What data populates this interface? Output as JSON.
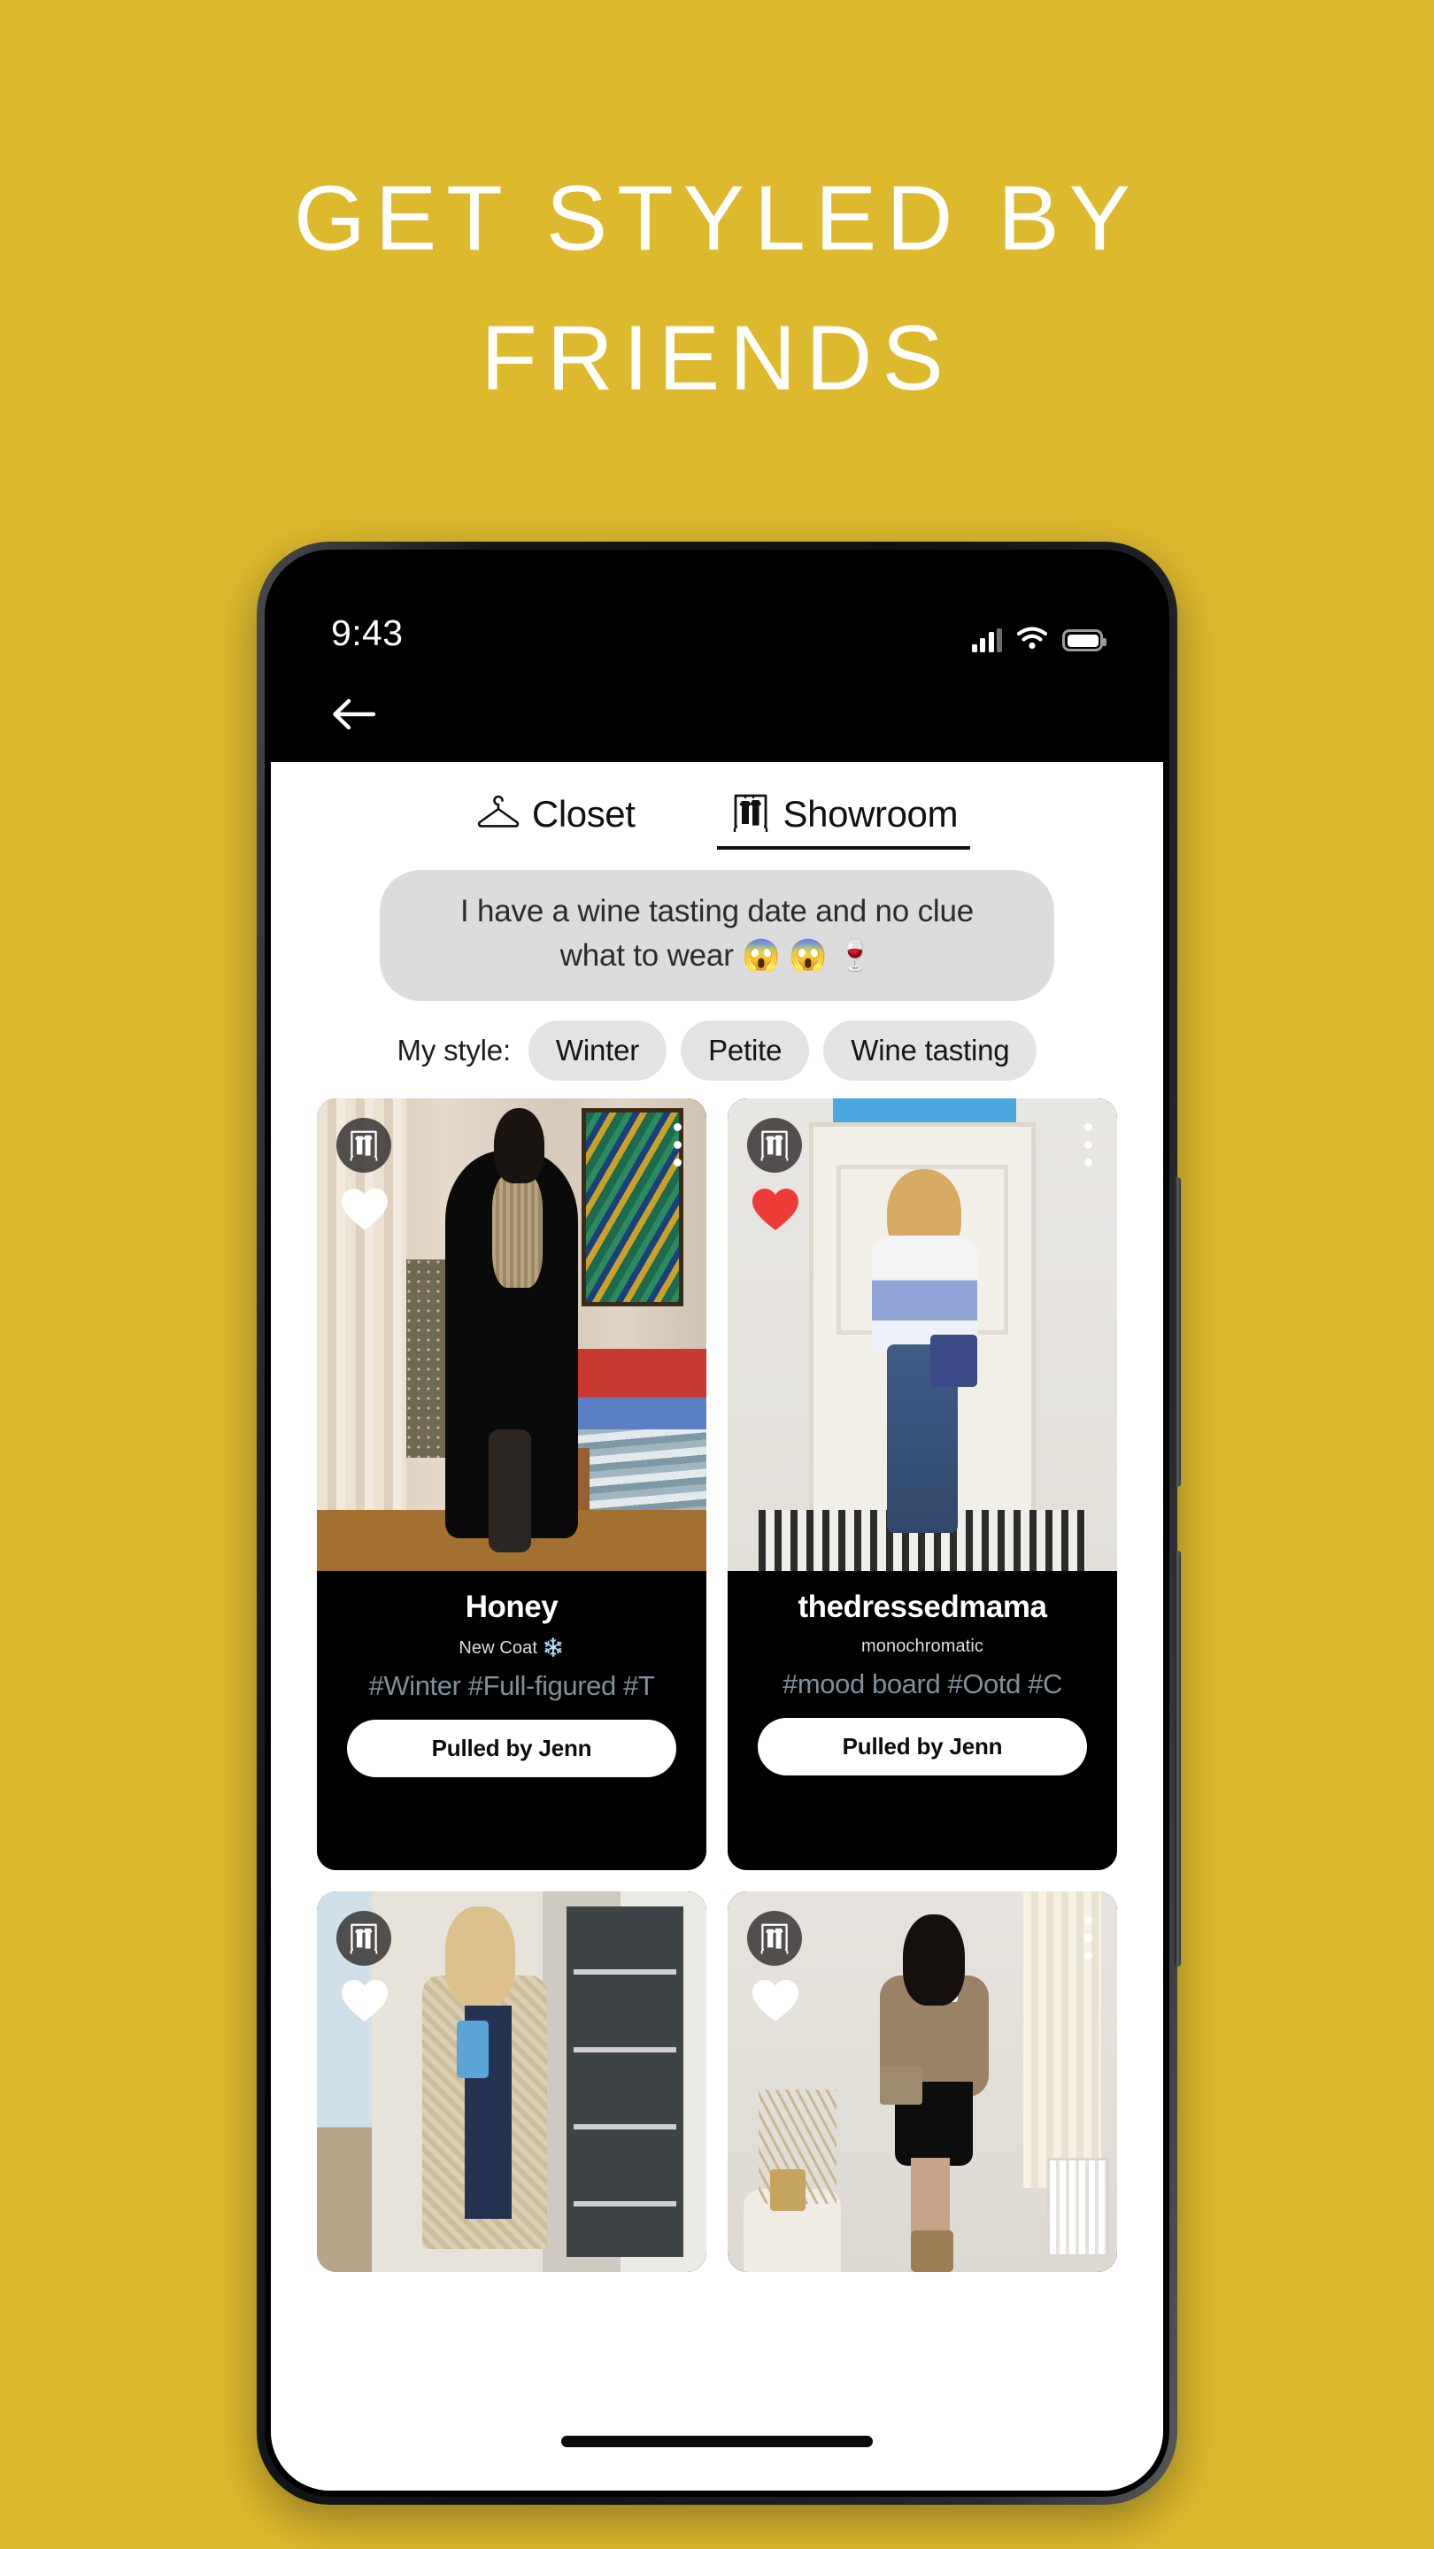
{
  "theme": {
    "background_color": "#ddb92e",
    "headline_color": "#ffffff",
    "card_background": "#000000",
    "liked_heart_color": "#ef3b36",
    "unliked_heart_color": "#ffffff",
    "tag_color": "#7e909b"
  },
  "headline": {
    "line1": "GET STYLED BY",
    "line2": "FRIENDS"
  },
  "status_bar": {
    "time": "9:43",
    "signal_icon": "cellular-signal-icon",
    "wifi_icon": "wifi-icon",
    "battery_icon": "battery-icon"
  },
  "nav": {
    "back_icon": "back-arrow-icon"
  },
  "tabs": [
    {
      "label": "Closet",
      "icon": "clothes-hanger-icon",
      "active": false
    },
    {
      "label": "Showroom",
      "icon": "clothing-rack-icon",
      "active": true
    }
  ],
  "prompt": {
    "line1": "I have a wine tasting date and no clue",
    "line2": "what to wear 😱 😱 🍷"
  },
  "style_filter": {
    "label": "My style:",
    "chips": [
      "Winter",
      "Petite",
      "Wine tasting"
    ]
  },
  "cards": [
    {
      "user": "Honey",
      "subtitle": "New Coat ❄️",
      "tags": "#Winter #Full-figured #T",
      "action_label": "Pulled by Jenn",
      "badge_icon": "clothing-rack-icon",
      "heart_icon": "heart-icon",
      "liked": false,
      "has_menu": true,
      "menu_icon": "more-options-icon"
    },
    {
      "user": "thedressedmama",
      "subtitle": "monochromatic",
      "tags": "#mood board #Ootd #C",
      "action_label": "Pulled by Jenn",
      "badge_icon": "clothing-rack-icon",
      "heart_icon": "heart-icon",
      "liked": true,
      "has_menu": true,
      "menu_icon": "more-options-icon"
    },
    {
      "user": "",
      "subtitle": "",
      "tags": "",
      "action_label": "",
      "badge_icon": "clothing-rack-icon",
      "heart_icon": "heart-icon",
      "liked": false,
      "has_menu": false,
      "menu_icon": "more-options-icon"
    },
    {
      "user": "",
      "subtitle": "",
      "tags": "",
      "action_label": "",
      "badge_icon": "clothing-rack-icon",
      "heart_icon": "heart-icon",
      "liked": false,
      "has_menu": true,
      "menu_icon": "more-options-icon"
    }
  ],
  "home_indicator": "home-indicator-bar"
}
